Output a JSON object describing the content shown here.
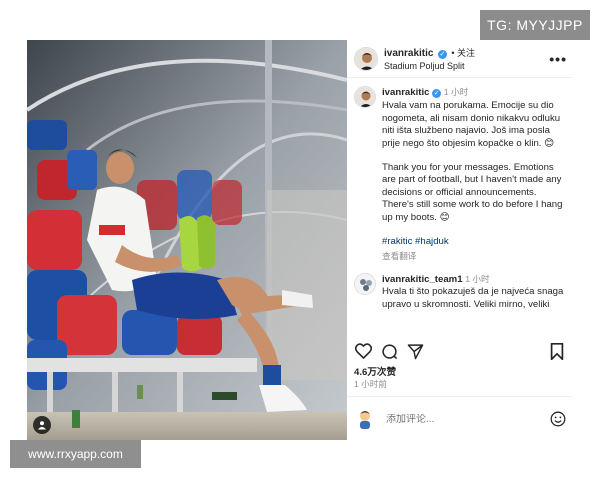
{
  "watermarks": {
    "top": "TG: MYYJJPP",
    "bottom": "www.rrxyapp.com"
  },
  "post": {
    "header": {
      "username": "ivanrakitic",
      "verified_mark": "✓",
      "separator": " • ",
      "follow_label": "关注",
      "location": "Stadium Poljud Split",
      "more_label": "•••"
    },
    "caption": {
      "username": "ivanrakitic",
      "time": "1 小时",
      "text_hr": "Hvala vam na porukama. Emocije su dio nogometa, ali nisam donio nikakvu odluku niti išta službeno najavio. Još ima posla prije nego što objesim kopačke o klin. 😊",
      "text_en": "Thank you for your messages. Emotions are part of football, but I haven't made any decisions or official announcements. There's still some work to do before I hang up my boots. 😊",
      "hashtags": "#rakitic #hajduk",
      "translate_label": "查看翻译"
    },
    "comment": {
      "username": "ivanrakitic_team1",
      "time": "1 小时",
      "text": "Hvala ti što pokazuješ da je najveća snaga upravo u skromnosti. Veliki mirno, veliki"
    },
    "likes": "4.6万次赞",
    "posted_ago": "1 小时前",
    "add_comment_placeholder": "添加评论...",
    "icons": [
      "heart-icon",
      "comment-icon",
      "share-icon",
      "bookmark-icon",
      "sticker-icon",
      "emoji-icon",
      "tagged-user-icon",
      "more-icon"
    ]
  }
}
